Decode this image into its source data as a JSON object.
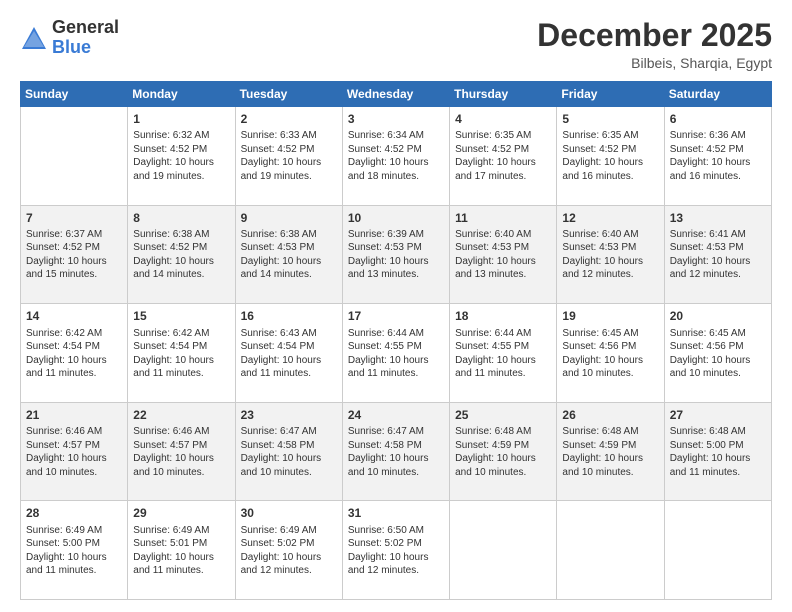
{
  "logo": {
    "general": "General",
    "blue": "Blue"
  },
  "title": "December 2025",
  "location": "Bilbeis, Sharqia, Egypt",
  "days_header": [
    "Sunday",
    "Monday",
    "Tuesday",
    "Wednesday",
    "Thursday",
    "Friday",
    "Saturday"
  ],
  "weeks": [
    [
      {
        "day": "",
        "lines": []
      },
      {
        "day": "1",
        "lines": [
          "Sunrise: 6:32 AM",
          "Sunset: 4:52 PM",
          "Daylight: 10 hours",
          "and 19 minutes."
        ]
      },
      {
        "day": "2",
        "lines": [
          "Sunrise: 6:33 AM",
          "Sunset: 4:52 PM",
          "Daylight: 10 hours",
          "and 19 minutes."
        ]
      },
      {
        "day": "3",
        "lines": [
          "Sunrise: 6:34 AM",
          "Sunset: 4:52 PM",
          "Daylight: 10 hours",
          "and 18 minutes."
        ]
      },
      {
        "day": "4",
        "lines": [
          "Sunrise: 6:35 AM",
          "Sunset: 4:52 PM",
          "Daylight: 10 hours",
          "and 17 minutes."
        ]
      },
      {
        "day": "5",
        "lines": [
          "Sunrise: 6:35 AM",
          "Sunset: 4:52 PM",
          "Daylight: 10 hours",
          "and 16 minutes."
        ]
      },
      {
        "day": "6",
        "lines": [
          "Sunrise: 6:36 AM",
          "Sunset: 4:52 PM",
          "Daylight: 10 hours",
          "and 16 minutes."
        ]
      }
    ],
    [
      {
        "day": "7",
        "lines": [
          "Sunrise: 6:37 AM",
          "Sunset: 4:52 PM",
          "Daylight: 10 hours",
          "and 15 minutes."
        ]
      },
      {
        "day": "8",
        "lines": [
          "Sunrise: 6:38 AM",
          "Sunset: 4:52 PM",
          "Daylight: 10 hours",
          "and 14 minutes."
        ]
      },
      {
        "day": "9",
        "lines": [
          "Sunrise: 6:38 AM",
          "Sunset: 4:53 PM",
          "Daylight: 10 hours",
          "and 14 minutes."
        ]
      },
      {
        "day": "10",
        "lines": [
          "Sunrise: 6:39 AM",
          "Sunset: 4:53 PM",
          "Daylight: 10 hours",
          "and 13 minutes."
        ]
      },
      {
        "day": "11",
        "lines": [
          "Sunrise: 6:40 AM",
          "Sunset: 4:53 PM",
          "Daylight: 10 hours",
          "and 13 minutes."
        ]
      },
      {
        "day": "12",
        "lines": [
          "Sunrise: 6:40 AM",
          "Sunset: 4:53 PM",
          "Daylight: 10 hours",
          "and 12 minutes."
        ]
      },
      {
        "day": "13",
        "lines": [
          "Sunrise: 6:41 AM",
          "Sunset: 4:53 PM",
          "Daylight: 10 hours",
          "and 12 minutes."
        ]
      }
    ],
    [
      {
        "day": "14",
        "lines": [
          "Sunrise: 6:42 AM",
          "Sunset: 4:54 PM",
          "Daylight: 10 hours",
          "and 11 minutes."
        ]
      },
      {
        "day": "15",
        "lines": [
          "Sunrise: 6:42 AM",
          "Sunset: 4:54 PM",
          "Daylight: 10 hours",
          "and 11 minutes."
        ]
      },
      {
        "day": "16",
        "lines": [
          "Sunrise: 6:43 AM",
          "Sunset: 4:54 PM",
          "Daylight: 10 hours",
          "and 11 minutes."
        ]
      },
      {
        "day": "17",
        "lines": [
          "Sunrise: 6:44 AM",
          "Sunset: 4:55 PM",
          "Daylight: 10 hours",
          "and 11 minutes."
        ]
      },
      {
        "day": "18",
        "lines": [
          "Sunrise: 6:44 AM",
          "Sunset: 4:55 PM",
          "Daylight: 10 hours",
          "and 11 minutes."
        ]
      },
      {
        "day": "19",
        "lines": [
          "Sunrise: 6:45 AM",
          "Sunset: 4:56 PM",
          "Daylight: 10 hours",
          "and 10 minutes."
        ]
      },
      {
        "day": "20",
        "lines": [
          "Sunrise: 6:45 AM",
          "Sunset: 4:56 PM",
          "Daylight: 10 hours",
          "and 10 minutes."
        ]
      }
    ],
    [
      {
        "day": "21",
        "lines": [
          "Sunrise: 6:46 AM",
          "Sunset: 4:57 PM",
          "Daylight: 10 hours",
          "and 10 minutes."
        ]
      },
      {
        "day": "22",
        "lines": [
          "Sunrise: 6:46 AM",
          "Sunset: 4:57 PM",
          "Daylight: 10 hours",
          "and 10 minutes."
        ]
      },
      {
        "day": "23",
        "lines": [
          "Sunrise: 6:47 AM",
          "Sunset: 4:58 PM",
          "Daylight: 10 hours",
          "and 10 minutes."
        ]
      },
      {
        "day": "24",
        "lines": [
          "Sunrise: 6:47 AM",
          "Sunset: 4:58 PM",
          "Daylight: 10 hours",
          "and 10 minutes."
        ]
      },
      {
        "day": "25",
        "lines": [
          "Sunrise: 6:48 AM",
          "Sunset: 4:59 PM",
          "Daylight: 10 hours",
          "and 10 minutes."
        ]
      },
      {
        "day": "26",
        "lines": [
          "Sunrise: 6:48 AM",
          "Sunset: 4:59 PM",
          "Daylight: 10 hours",
          "and 10 minutes."
        ]
      },
      {
        "day": "27",
        "lines": [
          "Sunrise: 6:48 AM",
          "Sunset: 5:00 PM",
          "Daylight: 10 hours",
          "and 11 minutes."
        ]
      }
    ],
    [
      {
        "day": "28",
        "lines": [
          "Sunrise: 6:49 AM",
          "Sunset: 5:00 PM",
          "Daylight: 10 hours",
          "and 11 minutes."
        ]
      },
      {
        "day": "29",
        "lines": [
          "Sunrise: 6:49 AM",
          "Sunset: 5:01 PM",
          "Daylight: 10 hours",
          "and 11 minutes."
        ]
      },
      {
        "day": "30",
        "lines": [
          "Sunrise: 6:49 AM",
          "Sunset: 5:02 PM",
          "Daylight: 10 hours",
          "and 12 minutes."
        ]
      },
      {
        "day": "31",
        "lines": [
          "Sunrise: 6:50 AM",
          "Sunset: 5:02 PM",
          "Daylight: 10 hours",
          "and 12 minutes."
        ]
      },
      {
        "day": "",
        "lines": []
      },
      {
        "day": "",
        "lines": []
      },
      {
        "day": "",
        "lines": []
      }
    ]
  ]
}
